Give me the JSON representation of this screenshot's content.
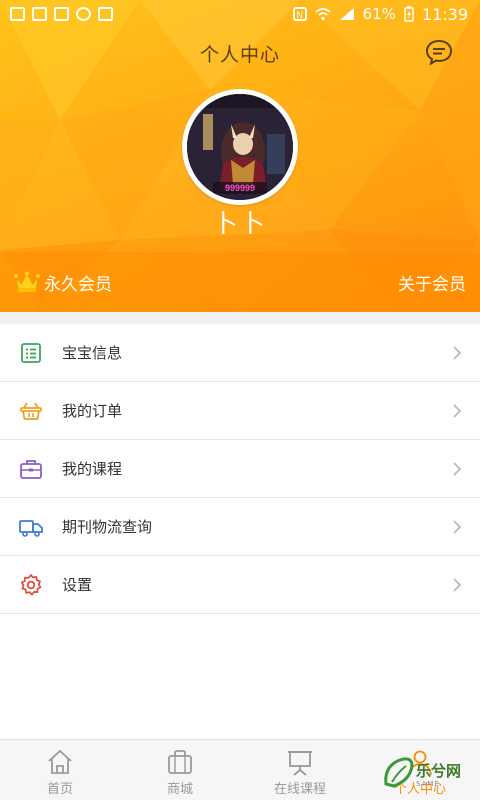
{
  "status_bar": {
    "battery": "61%",
    "time": "11:39"
  },
  "header": {
    "title": "个人中心",
    "username": "卜卜",
    "avatar_caption": "999999"
  },
  "membership": {
    "level": "永久会员",
    "about_link": "关于会员"
  },
  "menu": {
    "items": [
      {
        "label": "宝宝信息",
        "icon": "list-icon",
        "color": "#3aa55d"
      },
      {
        "label": "我的订单",
        "icon": "basket-icon",
        "color": "#f0a020"
      },
      {
        "label": "我的课程",
        "icon": "briefcase-icon",
        "color": "#8a5cc7"
      },
      {
        "label": "期刊物流查询",
        "icon": "truck-icon",
        "color": "#3b7ed8"
      },
      {
        "label": "设置",
        "icon": "gear-icon",
        "color": "#e04a3a"
      }
    ]
  },
  "tabbar": {
    "tabs": [
      {
        "label": "首页",
        "icon": "home-icon"
      },
      {
        "label": "商城",
        "icon": "shopping-bag-icon"
      },
      {
        "label": "在线课程",
        "icon": "presentation-board-icon"
      },
      {
        "label": "个人中心",
        "icon": "person-icon",
        "active": true
      }
    ]
  },
  "watermark": {
    "text": "乐兮网",
    "sub": "SAME"
  },
  "colors": {
    "accent": "#ff8c00",
    "header_gradient_start": "#ffc21a",
    "header_gradient_end": "#ff8f0c"
  }
}
